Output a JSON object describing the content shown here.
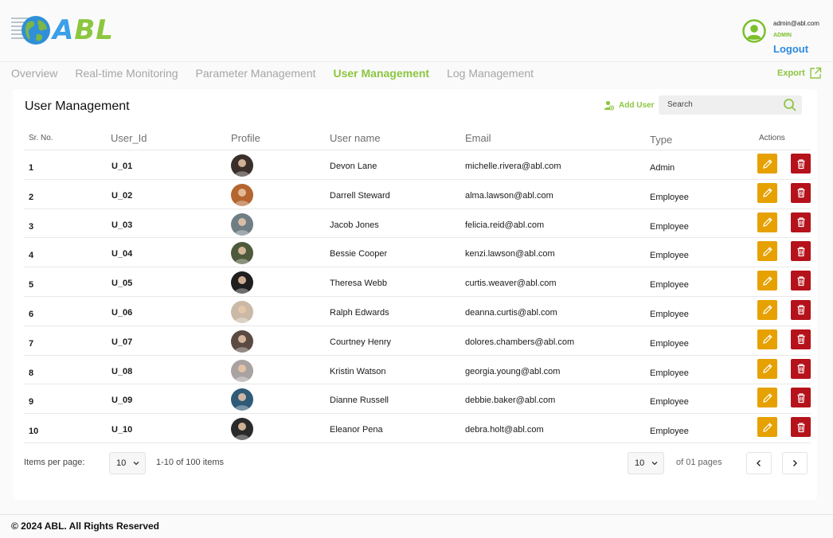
{
  "app": {
    "logo_text_a": "A",
    "logo_text_bl": "BL"
  },
  "account": {
    "email": "admin@abl.com",
    "role": "ADMIN",
    "logout_label": "Logout"
  },
  "nav": {
    "tabs": [
      {
        "label": "Overview",
        "active": false
      },
      {
        "label": "Real-time Monitoring",
        "active": false
      },
      {
        "label": "Parameter Management",
        "active": false
      },
      {
        "label": "User Management",
        "active": true
      },
      {
        "label": "Log Management",
        "active": false
      }
    ],
    "export_label": "Export"
  },
  "page": {
    "title": "User Management",
    "add_user_label": "Add User",
    "search_placeholder": "Search"
  },
  "table": {
    "headers": {
      "sr": "Sr. No.",
      "user_id": "User_Id",
      "profile": "Profile",
      "username": "User name",
      "email": "Email",
      "type": "Type",
      "actions": "Actions"
    },
    "rows": [
      {
        "sr": "1",
        "user_id": "U_01",
        "name": "Devon Lane",
        "email": "michelle.rivera@abl.com",
        "type": "Admin",
        "avatar_color": "#3a2f2a"
      },
      {
        "sr": "2",
        "user_id": "U_02",
        "name": "Darrell Steward",
        "email": "alma.lawson@abl.com",
        "type": "Employee",
        "avatar_color": "#b5652e"
      },
      {
        "sr": "3",
        "user_id": "U_03",
        "name": "Jacob Jones",
        "email": "felicia.reid@abl.com",
        "type": "Employee",
        "avatar_color": "#6f7e84"
      },
      {
        "sr": "4",
        "user_id": "U_04",
        "name": "Bessie Cooper",
        "email": "kenzi.lawson@abl.com",
        "type": "Employee",
        "avatar_color": "#4d5a3b"
      },
      {
        "sr": "5",
        "user_id": "U_05",
        "name": "Theresa Webb",
        "email": "curtis.weaver@abl.com",
        "type": "Employee",
        "avatar_color": "#1f1f1f"
      },
      {
        "sr": "6",
        "user_id": "U_06",
        "name": "Ralph Edwards",
        "email": "deanna.curtis@abl.com",
        "type": "Employee",
        "avatar_color": "#c9b9a6"
      },
      {
        "sr": "7",
        "user_id": "U_07",
        "name": "Courtney Henry",
        "email": "dolores.chambers@abl.com",
        "type": "Employee",
        "avatar_color": "#5a4a42"
      },
      {
        "sr": "8",
        "user_id": "U_08",
        "name": "Kristin Watson",
        "email": "georgia.young@abl.com",
        "type": "Employee",
        "avatar_color": "#a8a2a0"
      },
      {
        "sr": "9",
        "user_id": "U_09",
        "name": "Dianne Russell",
        "email": "debbie.baker@abl.com",
        "type": "Employee",
        "avatar_color": "#2f5b78"
      },
      {
        "sr": "10",
        "user_id": "U_10",
        "name": "Eleanor Pena",
        "email": "debra.holt@abl.com",
        "type": "Employee",
        "avatar_color": "#2a2a2a"
      }
    ]
  },
  "pagination": {
    "items_per_page_label": "Items per page:",
    "items_per_page_value": "10",
    "items_range": "1-10 of 100 items",
    "page_value": "10",
    "of_pages": "of 01 pages"
  },
  "footer": {
    "copyright": "© 2024 ABL. All Rights Reserved"
  },
  "colors": {
    "brand_green": "#8cc63f",
    "brand_blue": "#3aa0e8",
    "edit": "#e6a100",
    "delete": "#b5121b"
  }
}
